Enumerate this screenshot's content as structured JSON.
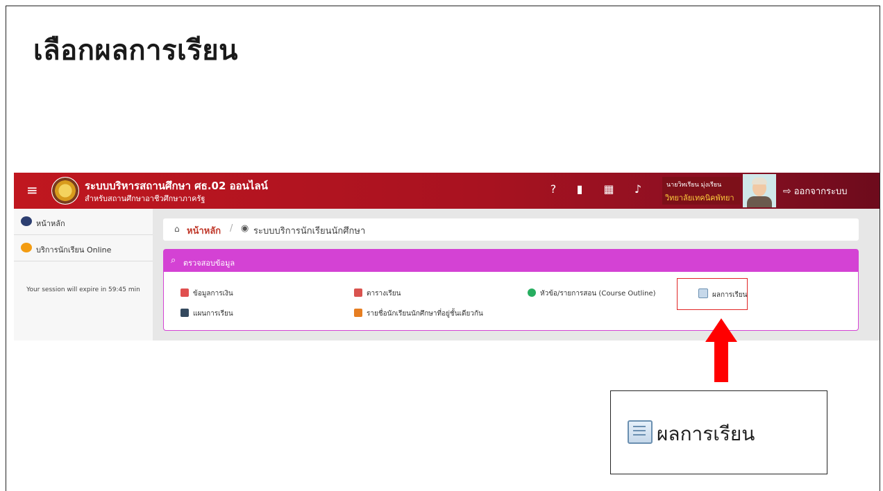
{
  "slide": {
    "title": "เลือกผลการเรียน"
  },
  "app": {
    "brand": {
      "title": "ระบบบริหารสถานศึกษา ศธ.02 ออนไลน์",
      "subtitle": "สำหรับสถานศึกษาอาชีวศึกษาภาครัฐ"
    },
    "topbar_icons": [
      "question-icon",
      "book-icon",
      "calendar-icon",
      "bell-icon"
    ],
    "user": {
      "name": "นายวิทเรียน มุ่งเรียน",
      "school": "วิทยาลัยเทคนิคพัทยา"
    },
    "logout_label": "ออกจากระบบ",
    "sidebar": {
      "items": [
        {
          "label": "หน้าหลัก",
          "icon": "dashboard-icon"
        },
        {
          "label": "บริการนักเรียน Online",
          "icon": "student-icon"
        }
      ],
      "session_text": "Your session will expire in 59:45 min"
    },
    "breadcrumb": {
      "home": "หน้าหลัก",
      "separator": "/",
      "current": "ระบบบริการนักเรียนนักศึกษา"
    },
    "panel": {
      "title": "ตรวจสอบข้อมูล",
      "links": [
        {
          "label": "ข้อมูลการเงิน",
          "icon": "finance-icon",
          "color": "#e05050"
        },
        {
          "label": "ตารางเรียน",
          "icon": "timetable-icon",
          "color": "#d9534f"
        },
        {
          "label": "หัวข้อ/รายการสอน (Course Outline)",
          "icon": "check-circle-icon",
          "color": "#27ae60"
        },
        {
          "label": "ผลการเรียน",
          "icon": "document-icon",
          "color": "#6a8fb0"
        },
        {
          "label": "แผนการเรียน",
          "icon": "plan-icon",
          "color": "#34495e"
        },
        {
          "label": "รายชื่อนักเรียนนักศึกษาที่อยู่ชั้นเดียวกัน",
          "icon": "classmates-icon",
          "color": "#e67e22"
        }
      ]
    }
  },
  "callout": {
    "label": "ผลการเรียน"
  },
  "colors": {
    "topbar": "#c0171f",
    "panel_head": "#d442d4",
    "highlight": "#e02424",
    "arrow": "#ff0000"
  }
}
